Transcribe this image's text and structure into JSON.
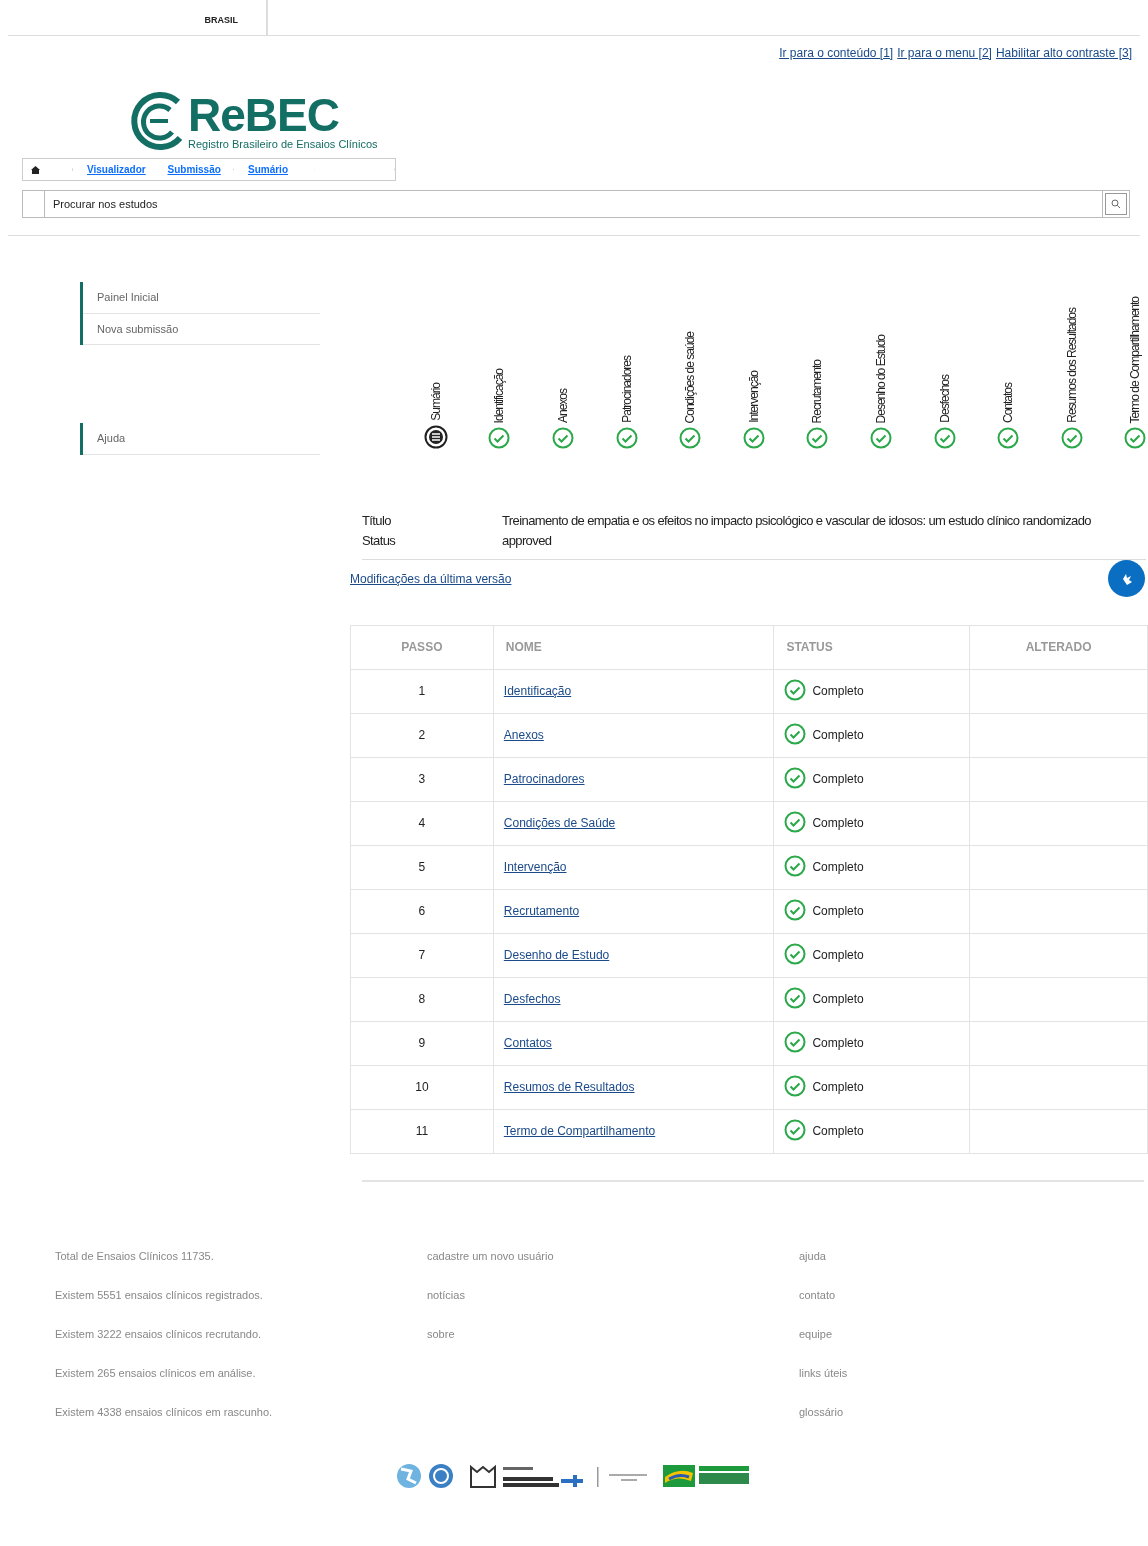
{
  "top_bar": {
    "brand": "BRASIL"
  },
  "access_links": [
    "Ir para o conteúdo [1]",
    "Ir para o menu [2]",
    "Habilitar alto contraste [3]"
  ],
  "logo": {
    "title": "ReBEC",
    "subtitle": "Registro Brasileiro de Ensaios Clínicos"
  },
  "breadcrumb": [
    "Visualizador",
    "Submissão",
    "Sumário"
  ],
  "search": {
    "placeholder": "Procurar nos estudos"
  },
  "sidebar": {
    "groups": [
      [
        "Painel Inicial",
        "Nova submissão"
      ],
      [
        "Ajuda"
      ]
    ]
  },
  "steps": [
    {
      "label": "Sumário",
      "kind": "summary"
    },
    {
      "label": "Identificação",
      "kind": "complete"
    },
    {
      "label": "Anexos",
      "kind": "complete"
    },
    {
      "label": "Patrocinadores",
      "kind": "complete"
    },
    {
      "label": "Condições de saúde",
      "kind": "complete"
    },
    {
      "label": "Intervenção",
      "kind": "complete"
    },
    {
      "label": "Recrutamento",
      "kind": "complete"
    },
    {
      "label": "Desenho do Estudo",
      "kind": "complete"
    },
    {
      "label": "Desfechos",
      "kind": "complete"
    },
    {
      "label": "Contatos",
      "kind": "complete"
    },
    {
      "label": "Resumos dos Resultados",
      "kind": "complete"
    },
    {
      "label": "Termo de Compartilhamento",
      "kind": "complete"
    }
  ],
  "details": [
    {
      "label": "Título",
      "value": "Treinamento de empatia e os efeitos no impacto psicológico e vascular de idosos: um estudo clínico randomizado"
    },
    {
      "label": "Status",
      "value": "approved"
    }
  ],
  "changes_link": "Modificações da última versão",
  "table": {
    "columns": [
      "PASSO",
      "NOME",
      "STATUS",
      "ALTERADO"
    ],
    "rows": [
      {
        "step": "1",
        "name": "Identificação",
        "status": "Completo"
      },
      {
        "step": "2",
        "name": "Anexos",
        "status": "Completo"
      },
      {
        "step": "3",
        "name": "Patrocinadores",
        "status": "Completo"
      },
      {
        "step": "4",
        "name": "Condições de Saúde",
        "status": "Completo"
      },
      {
        "step": "5",
        "name": "Intervenção",
        "status": "Completo"
      },
      {
        "step": "6",
        "name": "Recrutamento",
        "status": "Completo"
      },
      {
        "step": "7",
        "name": "Desenho de Estudo",
        "status": "Completo"
      },
      {
        "step": "8",
        "name": "Desfechos",
        "status": "Completo"
      },
      {
        "step": "9",
        "name": "Contatos",
        "status": "Completo"
      },
      {
        "step": "10",
        "name": "Resumos de Resultados",
        "status": "Completo"
      },
      {
        "step": "11",
        "name": "Termo de Compartilhamento",
        "status": "Completo"
      }
    ]
  },
  "footer": {
    "columns": [
      [
        "Total de Ensaios Clínicos 11735.",
        "Existem 5551 ensaios clínicos registrados.",
        "Existem 3222 ensaios clínicos recrutando.",
        "Existem 265 ensaios clínicos em análise.",
        "Existem 4338 ensaios clínicos em rascunho."
      ],
      [
        "cadastre um novo usuário",
        "notícias",
        "sobre"
      ],
      [
        "ajuda",
        "contato",
        "equipe",
        "links úteis",
        "glossário"
      ]
    ]
  }
}
